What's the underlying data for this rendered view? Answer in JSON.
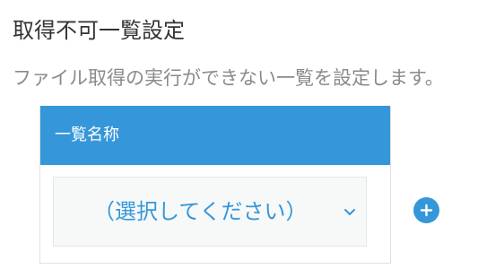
{
  "page": {
    "title": "取得不可一覧設定",
    "description": "ファイル取得の実行ができない一覧を設定します。"
  },
  "list_table": {
    "column_header": "一覧名称",
    "select": {
      "selected_value": "（選択してください）"
    }
  },
  "icons": {
    "select_chevron": "chevron-down-icon",
    "add": "plus-icon"
  },
  "colors": {
    "accent": "#3596d9",
    "description_text": "#8a8a8a",
    "select_background": "#f7f9f9"
  }
}
